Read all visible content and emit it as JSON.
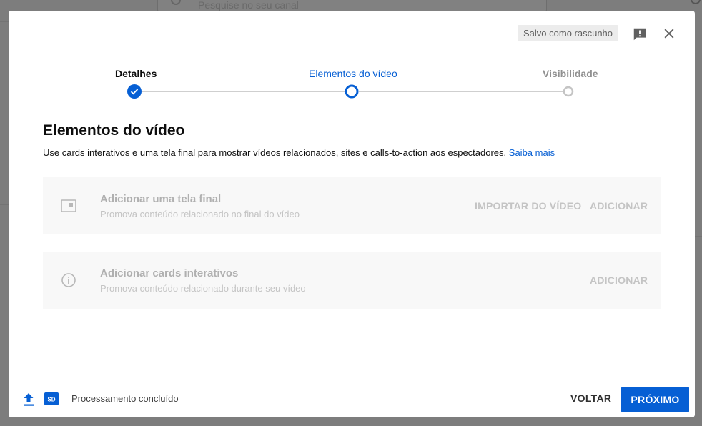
{
  "background": {
    "search_placeholder": "Pesquise no seu canal"
  },
  "header": {
    "draft_status": "Salvo como rascunho",
    "feedback_icon": "feedback-icon",
    "close_icon": "close-icon"
  },
  "stepper": {
    "steps": [
      {
        "label": "Detalhes",
        "state": "complete"
      },
      {
        "label": "Elementos do vídeo",
        "state": "active"
      },
      {
        "label": "Visibilidade",
        "state": "pending"
      }
    ]
  },
  "main": {
    "title": "Elementos do vídeo",
    "description": "Use cards interativos e uma tela final para mostrar vídeos relacionados, sites e calls-to-action aos espectadores.",
    "learn_more": "Saiba mais",
    "cards": [
      {
        "icon": "end-screen-icon",
        "title": "Adicionar uma tela final",
        "subtitle": "Promova conteúdo relacionado no final do vídeo",
        "import_label": "IMPORTAR DO VÍDEO",
        "add_label": "ADICIONAR"
      },
      {
        "icon": "info-icon",
        "title": "Adicionar cards interativos",
        "subtitle": "Promova conteúdo relacionado durante seu vídeo",
        "add_label": "ADICIONAR"
      }
    ]
  },
  "footer": {
    "upload_icon": "upload-icon",
    "sd_badge": "SD",
    "status": "Processamento concluído",
    "back_label": "VOLTAR",
    "next_label": "PRÓXIMO"
  },
  "colors": {
    "accent": "#065fd4",
    "disabled_text": "#c4c4c4",
    "card_bg": "#f8f8f8"
  }
}
